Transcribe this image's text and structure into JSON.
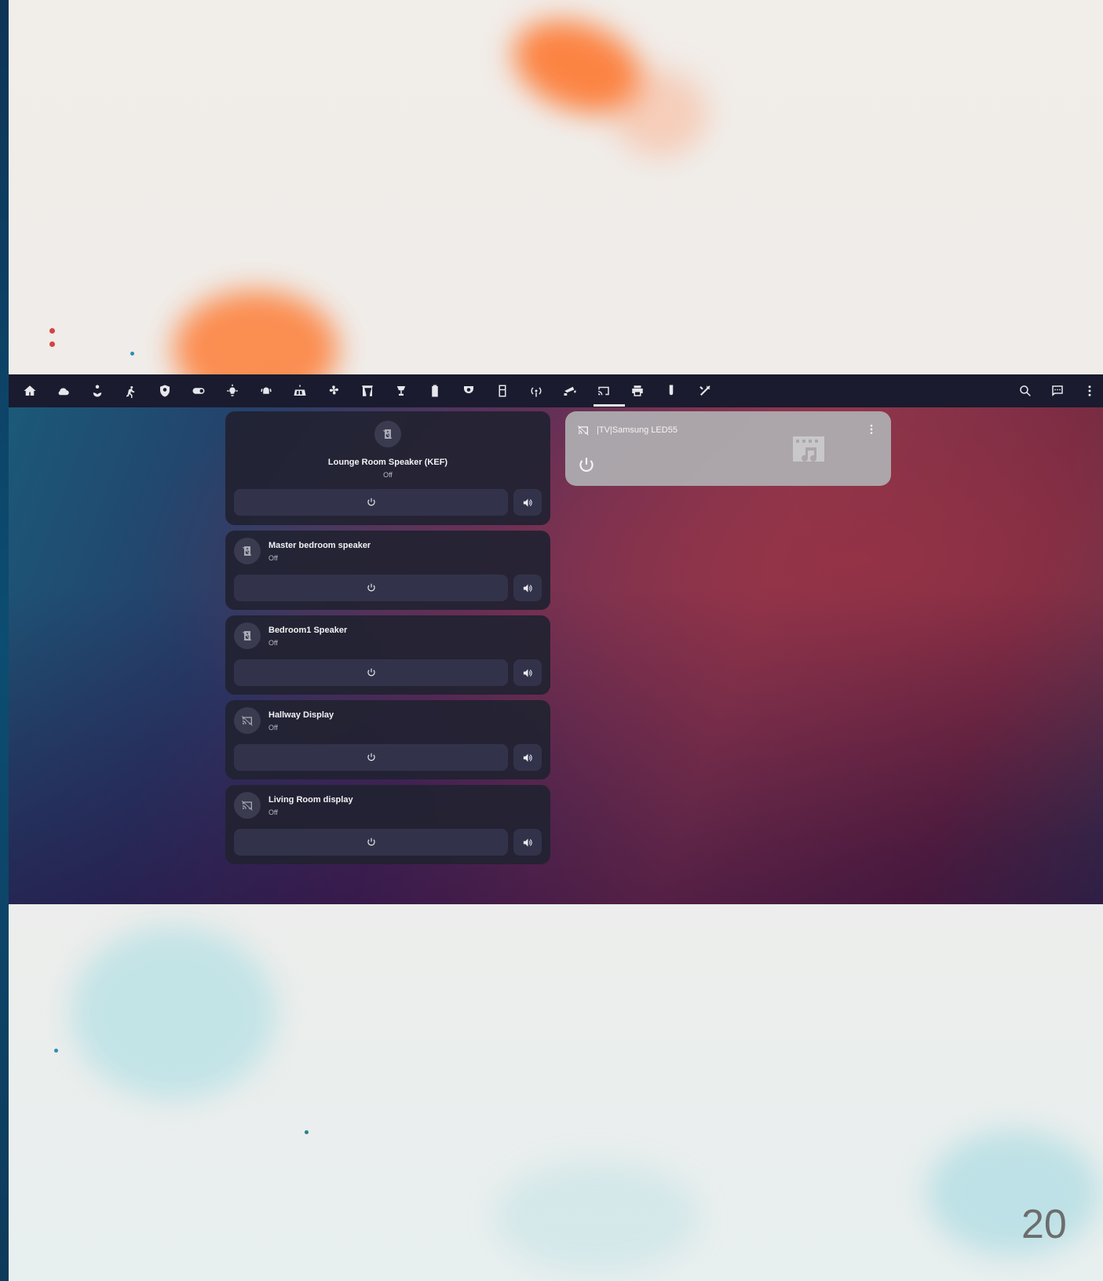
{
  "toolbar": {
    "icons": [
      "home-icon",
      "weather-icon",
      "garden-icon",
      "motion-icon",
      "security-icon",
      "switch-icon",
      "light-icon",
      "alarm-icon",
      "solar-icon",
      "aircon-icon",
      "curtains-icon",
      "lamp-icon",
      "battery-icon",
      "cctv-icon",
      "fridge-icon",
      "network-icon",
      "camera-icon",
      "cast-icon",
      "printer-icon",
      "sensor-icon",
      "tools-icon"
    ],
    "right_icons": [
      "search-icon",
      "chat-icon",
      "more-icon"
    ]
  },
  "devices": [
    {
      "name": "Lounge Room Speaker (KEF)",
      "state": "Off",
      "icon": "speaker-icon"
    },
    {
      "name": "Master bedroom speaker",
      "state": "Off",
      "icon": "speaker-icon"
    },
    {
      "name": "Bedroom1 Speaker",
      "state": "Off",
      "icon": "speaker-icon"
    },
    {
      "name": "Hallway Display",
      "state": "Off",
      "icon": "cast-off-icon"
    },
    {
      "name": "Living Room display",
      "state": "Off",
      "icon": "cast-off-icon"
    }
  ],
  "tv_card": {
    "title": "|TV|Samsung LED55",
    "icon": "cast-off-icon",
    "artwork_icon": "music-video-icon"
  },
  "slide": {
    "page_number": "20"
  }
}
